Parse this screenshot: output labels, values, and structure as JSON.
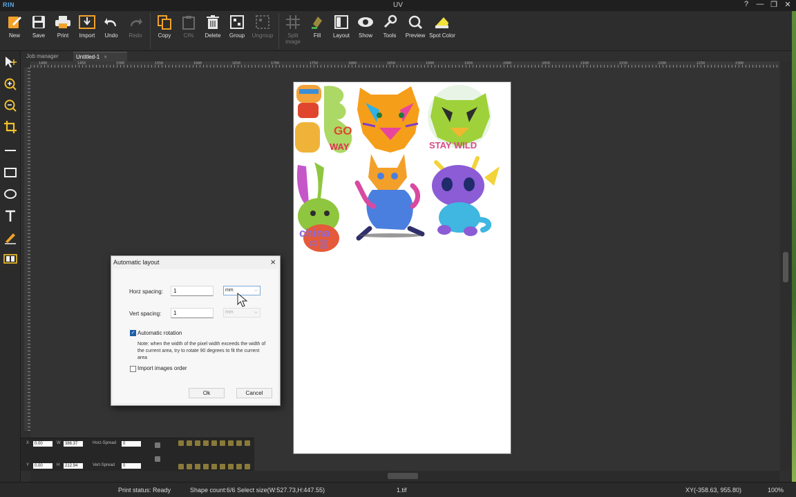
{
  "window": {
    "logo": "RIN",
    "title": "UV",
    "controls": [
      "?",
      "—",
      "❐",
      "✕"
    ]
  },
  "toolbar": [
    {
      "id": "new",
      "label": "New",
      "icon": "new-document-icon",
      "enabled": true
    },
    {
      "id": "save",
      "label": "Save",
      "icon": "save-icon",
      "enabled": true
    },
    {
      "id": "print",
      "label": "Print",
      "icon": "print-icon",
      "enabled": true
    },
    {
      "id": "import",
      "label": "Import",
      "icon": "import-icon",
      "enabled": true
    },
    {
      "id": "undo",
      "label": "Undo",
      "icon": "undo-icon",
      "enabled": true
    },
    {
      "id": "redo",
      "label": "Redo",
      "icon": "redo-icon",
      "enabled": false
    },
    {
      "id": "copy",
      "label": "Copy",
      "icon": "copy-icon",
      "enabled": true
    },
    {
      "id": "paste",
      "label": "Cl%",
      "icon": "paste-icon",
      "enabled": false
    },
    {
      "id": "delete",
      "label": "Delete",
      "icon": "delete-icon",
      "enabled": true
    },
    {
      "id": "group",
      "label": "Group",
      "icon": "group-icon",
      "enabled": true
    },
    {
      "id": "ungroup",
      "label": "Ungroup",
      "icon": "ungroup-icon",
      "enabled": false
    },
    {
      "id": "split",
      "label": "Split image",
      "icon": "split-image-icon",
      "enabled": false
    },
    {
      "id": "fill",
      "label": "Fill",
      "icon": "fill-icon",
      "enabled": true
    },
    {
      "id": "layout",
      "label": "Layout",
      "icon": "layout-icon",
      "enabled": true
    },
    {
      "id": "show",
      "label": "Show",
      "icon": "eye-icon",
      "enabled": true
    },
    {
      "id": "tools",
      "label": "Tools",
      "icon": "tools-icon",
      "enabled": true
    },
    {
      "id": "preview",
      "label": "Preview",
      "icon": "preview-icon",
      "enabled": true
    },
    {
      "id": "spot",
      "label": "Spot Color",
      "icon": "spot-color-icon",
      "enabled": true
    }
  ],
  "tabs": {
    "job_manager": "Job manager",
    "document": "Untitled-1",
    "close": "×"
  },
  "ruler_labels": [
    "1400",
    "1450",
    "1500",
    "1550",
    "1600",
    "1650",
    "1700",
    "1750",
    "1800",
    "1850",
    "1900",
    "1950",
    "2000",
    "2050",
    "2100",
    "2150",
    "2200",
    "2250",
    "2300"
  ],
  "transform_panel": {
    "x_label": "X",
    "y_label": "Y",
    "w_label": "W",
    "h_label": "H",
    "x_value": "0.00",
    "y_value": "0.00",
    "w_value": "386.37",
    "h_value": "212.94",
    "horz_spread_label": "Horz-Spread",
    "vert_spread_label": "Vert-Spread",
    "horz_spread_value": "0",
    "vert_spread_value": "0"
  },
  "dialog": {
    "title": "Automatic layout",
    "horz_spacing_label": "Horz spacing:",
    "horz_spacing_value": "1",
    "horz_unit": "mm",
    "vert_spacing_label": "Vert spacing:",
    "vert_spacing_value": "1",
    "vert_unit": "mm",
    "auto_rotation_label": "Automatic rotation",
    "auto_rotation_checked": true,
    "note": "Note: when the width of the pixel width exceeds the width of the current area, try to rotate 90 degrees to fit the current area",
    "import_order_label": "Import images order",
    "import_order_checked": false,
    "ok_label": "Ok",
    "cancel_label": "Cancel"
  },
  "artwork": [
    {
      "name": "burger-character-art",
      "colors": [
        "#f2a23a",
        "#e0462e",
        "#3b8ed6"
      ]
    },
    {
      "name": "tiger-head-art",
      "colors": [
        "#f59e1a",
        "#e8469c",
        "#2fb0e6"
      ]
    },
    {
      "name": "tiger-stay-wild-art",
      "colors": [
        "#9fd13a",
        "#f0b830",
        "#d84a8a"
      ]
    },
    {
      "name": "rabbit-china-art",
      "colors": [
        "#8fc63f",
        "#c557c9",
        "#e55a3a"
      ]
    },
    {
      "name": "cat-running-art",
      "colors": [
        "#f3a02a",
        "#4a7fe0",
        "#d84aa0"
      ]
    },
    {
      "name": "dragon-baby-art",
      "colors": [
        "#8b5cd6",
        "#3fb7e0",
        "#f2d33a"
      ]
    }
  ],
  "status": {
    "print_status": "Print status: Ready",
    "shape_count": "Shape count:6/6  Select size(W:527.73,H:447.55)",
    "file": "1.tif",
    "xy": "XY(-358.63, 955.80)",
    "zoom": "100%"
  },
  "colors": {
    "accent": "#1e5fa8",
    "background": "#2f2f2f",
    "page": "#ffffff"
  }
}
